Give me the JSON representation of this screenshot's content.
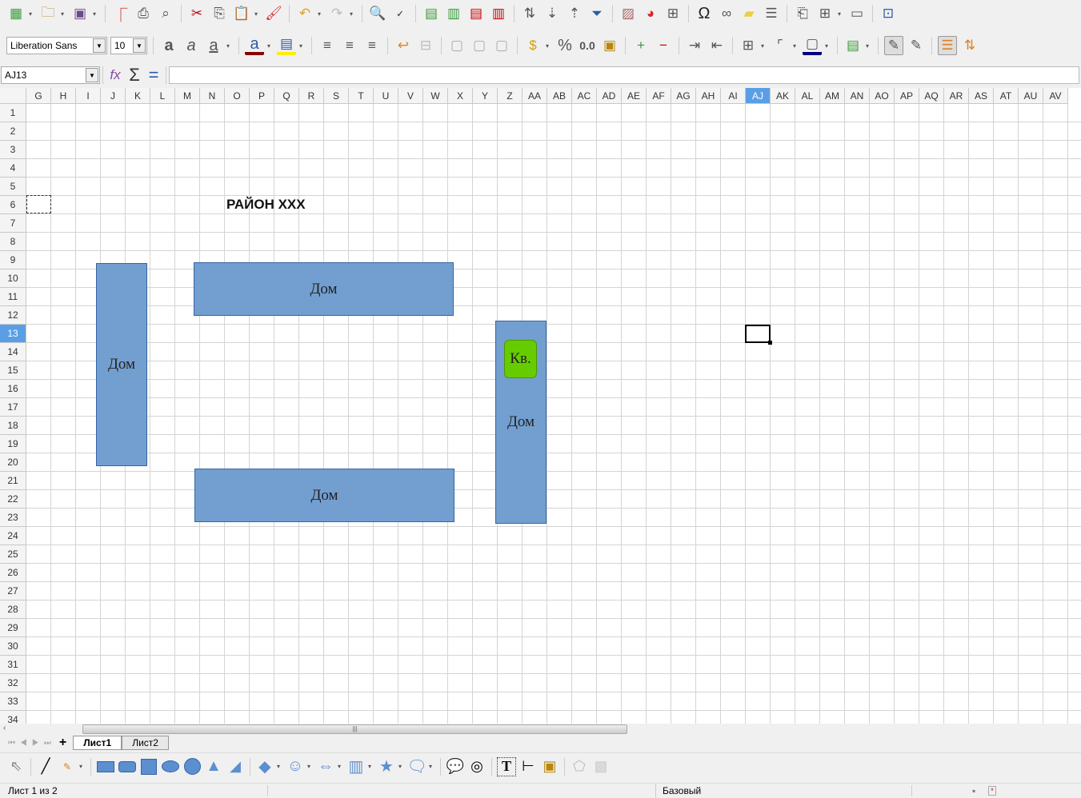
{
  "toolbar": {
    "font_name": "Liberation Sans",
    "font_size": "10"
  },
  "formula": {
    "name_box": "AJ13",
    "value": ""
  },
  "columns": [
    "G",
    "H",
    "I",
    "J",
    "K",
    "L",
    "M",
    "N",
    "O",
    "P",
    "Q",
    "R",
    "S",
    "T",
    "U",
    "V",
    "W",
    "X",
    "Y",
    "Z",
    "AA",
    "AB",
    "AC",
    "AD",
    "AE",
    "AF",
    "AG",
    "AH",
    "AI",
    "AJ",
    "AK",
    "AL",
    "AM",
    "AN",
    "AO",
    "AP",
    "AQ",
    "AR",
    "AS",
    "AT",
    "AU",
    "AV"
  ],
  "selected_column": "AJ",
  "selected_row": 13,
  "row_count": 34,
  "sheet": {
    "title": "РАЙОН XXX",
    "shapes": {
      "house_left": "Дом",
      "house_top": "Дом",
      "house_bottom": "Дом",
      "house_right": "Дом",
      "apartment": "Кв."
    }
  },
  "colors": {
    "shape_fill": "#729fcf",
    "apartment_fill": "#66cc00"
  },
  "tabs": {
    "sheet1": "Лист1",
    "sheet2": "Лист2"
  },
  "status": {
    "sheet_info": "Лист 1 из 2",
    "page_style": "Базовый"
  }
}
